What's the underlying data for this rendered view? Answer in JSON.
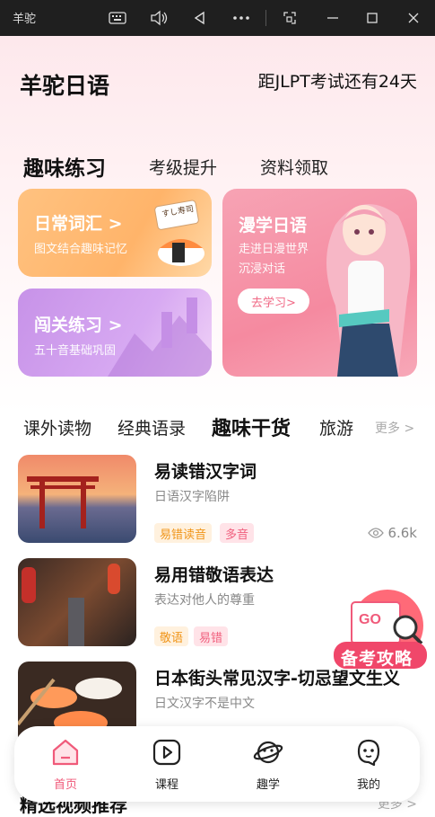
{
  "window": {
    "app_label": "羊驼",
    "icons": [
      "keyboard-icon",
      "volume-icon",
      "back-icon",
      "more-icon",
      "screenshot-icon",
      "minimize-icon",
      "maximize-icon",
      "close-icon"
    ]
  },
  "header": {
    "title": "羊驼日语",
    "countdown": "距JLPT考试还有24天"
  },
  "tabs": [
    {
      "label": "趣味练习",
      "active": true
    },
    {
      "label": "考级提升",
      "active": false
    },
    {
      "label": "资料领取",
      "active": false
    }
  ],
  "cards": {
    "vocab": {
      "title": "日常词汇 >",
      "subtitle": "图文结合趣味记忆",
      "sticker": "すし寿司"
    },
    "levels": {
      "title": "闯关练习 >",
      "subtitle": "五十音基础巩固"
    },
    "manga": {
      "title": "漫学日语",
      "subtitle1": "走进日漫世界",
      "subtitle2": "沉浸对话",
      "cta": "去学习>"
    }
  },
  "categories": {
    "items": [
      {
        "label": "课外读物",
        "active": false
      },
      {
        "label": "经典语录",
        "active": false
      },
      {
        "label": "趣味干货",
        "active": true
      },
      {
        "label": "旅游",
        "active": false
      }
    ],
    "more": "更多 >"
  },
  "articles": [
    {
      "title": "易读错汉字词",
      "subtitle": "日语汉字陷阱",
      "tags": [
        {
          "label": "易错读音",
          "style": "orange"
        },
        {
          "label": "多音",
          "style": "pink"
        }
      ],
      "views": "6.6k"
    },
    {
      "title": "易用错敬语表达",
      "subtitle": "表达对他人的尊重",
      "tags": [
        {
          "label": "敬语",
          "style": "orange"
        },
        {
          "label": "易错",
          "style": "pink"
        }
      ],
      "views": ""
    },
    {
      "title": "日本街头常见汉字-切忌望文生义",
      "subtitle": "日文汉字不是中文",
      "tags": [],
      "views": ""
    }
  ],
  "floating_badge": {
    "label": "备考攻略",
    "icon": "go-magnifier-icon"
  },
  "bottom_nav": [
    {
      "label": "首页",
      "icon": "home-icon",
      "active": true
    },
    {
      "label": "课程",
      "icon": "play-icon",
      "active": false
    },
    {
      "label": "趣学",
      "icon": "planet-icon",
      "active": false
    },
    {
      "label": "我的",
      "icon": "face-icon",
      "active": false
    }
  ],
  "section2": {
    "title": "精选视频推荐",
    "more": "更多 >"
  },
  "colors": {
    "accent": "#f05a7a",
    "orange": "#f0951a",
    "bg_pink": "#fde8ec"
  }
}
